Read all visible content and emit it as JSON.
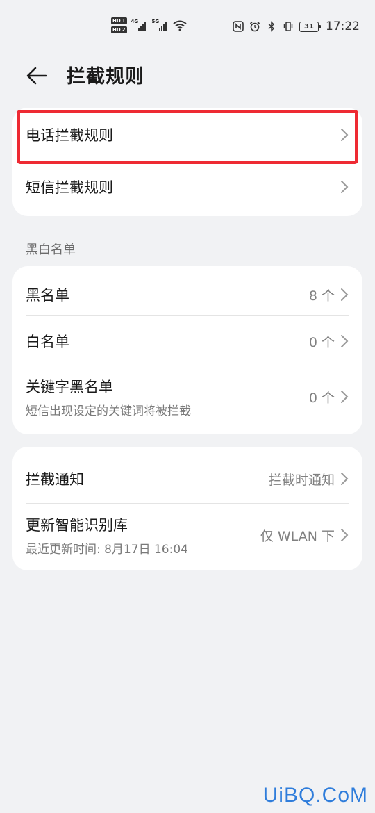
{
  "status_bar": {
    "sim1_label": "HD",
    "sim1_num": "1",
    "sim2_label": "HD",
    "sim2_num": "2",
    "net1": "4G",
    "net2": "5G",
    "battery": "31",
    "time": "17:22",
    "icons": [
      "nfc-icon",
      "alarm-icon",
      "bluetooth-icon",
      "vibrate-icon"
    ]
  },
  "header": {
    "back_icon": "arrow-left-icon",
    "title": "拦截规则"
  },
  "rules_card": {
    "items": [
      {
        "title": "电话拦截规则"
      },
      {
        "title": "短信拦截规则"
      }
    ]
  },
  "blacklist_section": {
    "label": "黑白名单",
    "items": [
      {
        "title": "黑名单",
        "value": "8 个"
      },
      {
        "title": "白名单",
        "value": "0 个"
      },
      {
        "title": "关键字黑名单",
        "subtitle": "短信出现设定的关键词将被拦截",
        "value": "0 个"
      }
    ]
  },
  "settings_card": {
    "items": [
      {
        "title": "拦截通知",
        "value": "拦截时通知"
      },
      {
        "title": "更新智能识别库",
        "subtitle": "最近更新时间: 8月17日 16:04",
        "value": "仅 WLAN 下"
      }
    ]
  },
  "watermark": "UiBQ.CoM",
  "highlight_color": "#ee2a33",
  "accent_color": "#2f7ddb"
}
